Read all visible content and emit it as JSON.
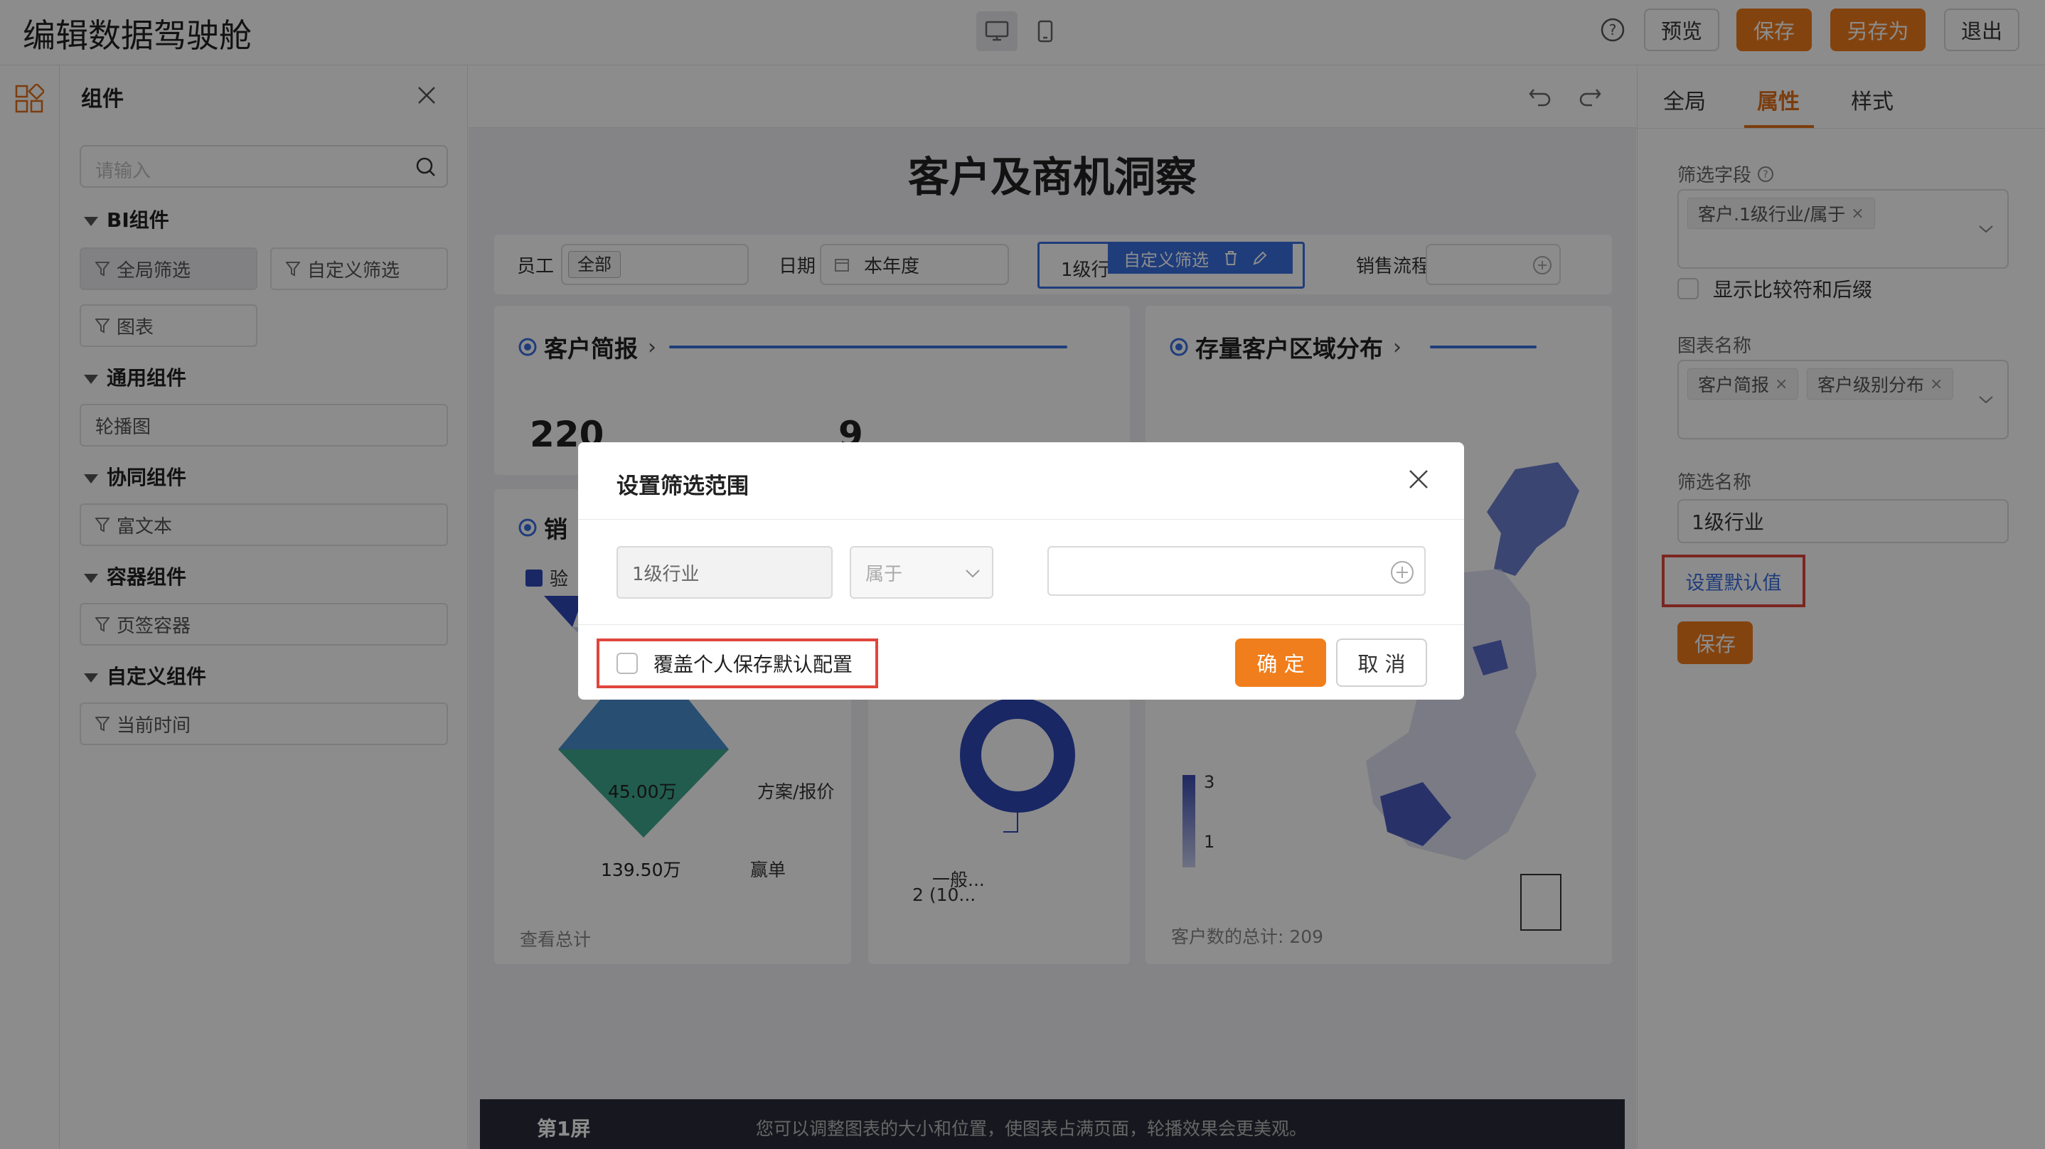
{
  "header": {
    "title": "编辑数据驾驶舱",
    "buttons": {
      "preview": "预览",
      "save": "保存",
      "save_as": "另存为",
      "exit": "退出"
    },
    "colors": {
      "accent": "#EE7A1C"
    }
  },
  "left_panel": {
    "title": "组件",
    "search_placeholder": "请输入",
    "groups": [
      {
        "title": "BI组件",
        "items": [
          "全局筛选",
          "自定义筛选",
          "图表"
        ]
      },
      {
        "title": "通用组件",
        "items": [
          "轮播图"
        ]
      },
      {
        "title": "协同组件",
        "items": [
          "富文本"
        ]
      },
      {
        "title": "容器组件",
        "items": [
          "页签容器"
        ]
      },
      {
        "title": "自定义组件",
        "items": [
          "当前时间"
        ]
      }
    ]
  },
  "right_panel": {
    "tabs": [
      "全局",
      "属性",
      "样式"
    ],
    "filter_field_label": "筛选字段",
    "filter_field_tags": [
      "客户.1级行业/属于"
    ],
    "show_compare_label": "显示比较符和后缀",
    "chart_name_label": "图表名称",
    "chart_name_tags": [
      "客户简报",
      "客户级别分布"
    ],
    "filter_name_label": "筛选名称",
    "filter_name_value": "1级行业",
    "set_default_link": "设置默认值",
    "save_button": "保存"
  },
  "canvas": {
    "dashboard_title": "客户及商机洞察",
    "filters": {
      "employee_label": "员工",
      "employee_value": "全部",
      "date_label": "日期",
      "date_value": "本年度",
      "industry_label": "1级行",
      "custom_filter_badge": "自定义筛选",
      "sales_process_label": "销售流程"
    },
    "cards": {
      "brief_title": "客户简报",
      "brief_values": [
        "220",
        "9"
      ],
      "region_title": "存量客户区域分布",
      "sales_title": "销",
      "funnel_legend": "验",
      "funnel_values": [
        {
          "value": "45.00万",
          "label": "方案/报价"
        },
        {
          "value": "139.50万",
          "label": "赢单"
        }
      ],
      "funnel_footer": "查看总计",
      "donut_label_1": "一般...",
      "donut_label_2": "2 (10...",
      "map_legend_max": "3",
      "map_legend_min": "1",
      "map_footer": "客户数的总计: 209"
    },
    "screen_bar": {
      "label": "第1屏",
      "hint": "您可以调整图表的大小和位置，使图表占满页面，轮播效果会更美观。"
    }
  },
  "modal": {
    "title": "设置筛选范围",
    "field_value": "1级行业",
    "operator_value": "属于",
    "override_label": "覆盖个人保存默认配置",
    "confirm": "确 定",
    "cancel": "取 消"
  }
}
